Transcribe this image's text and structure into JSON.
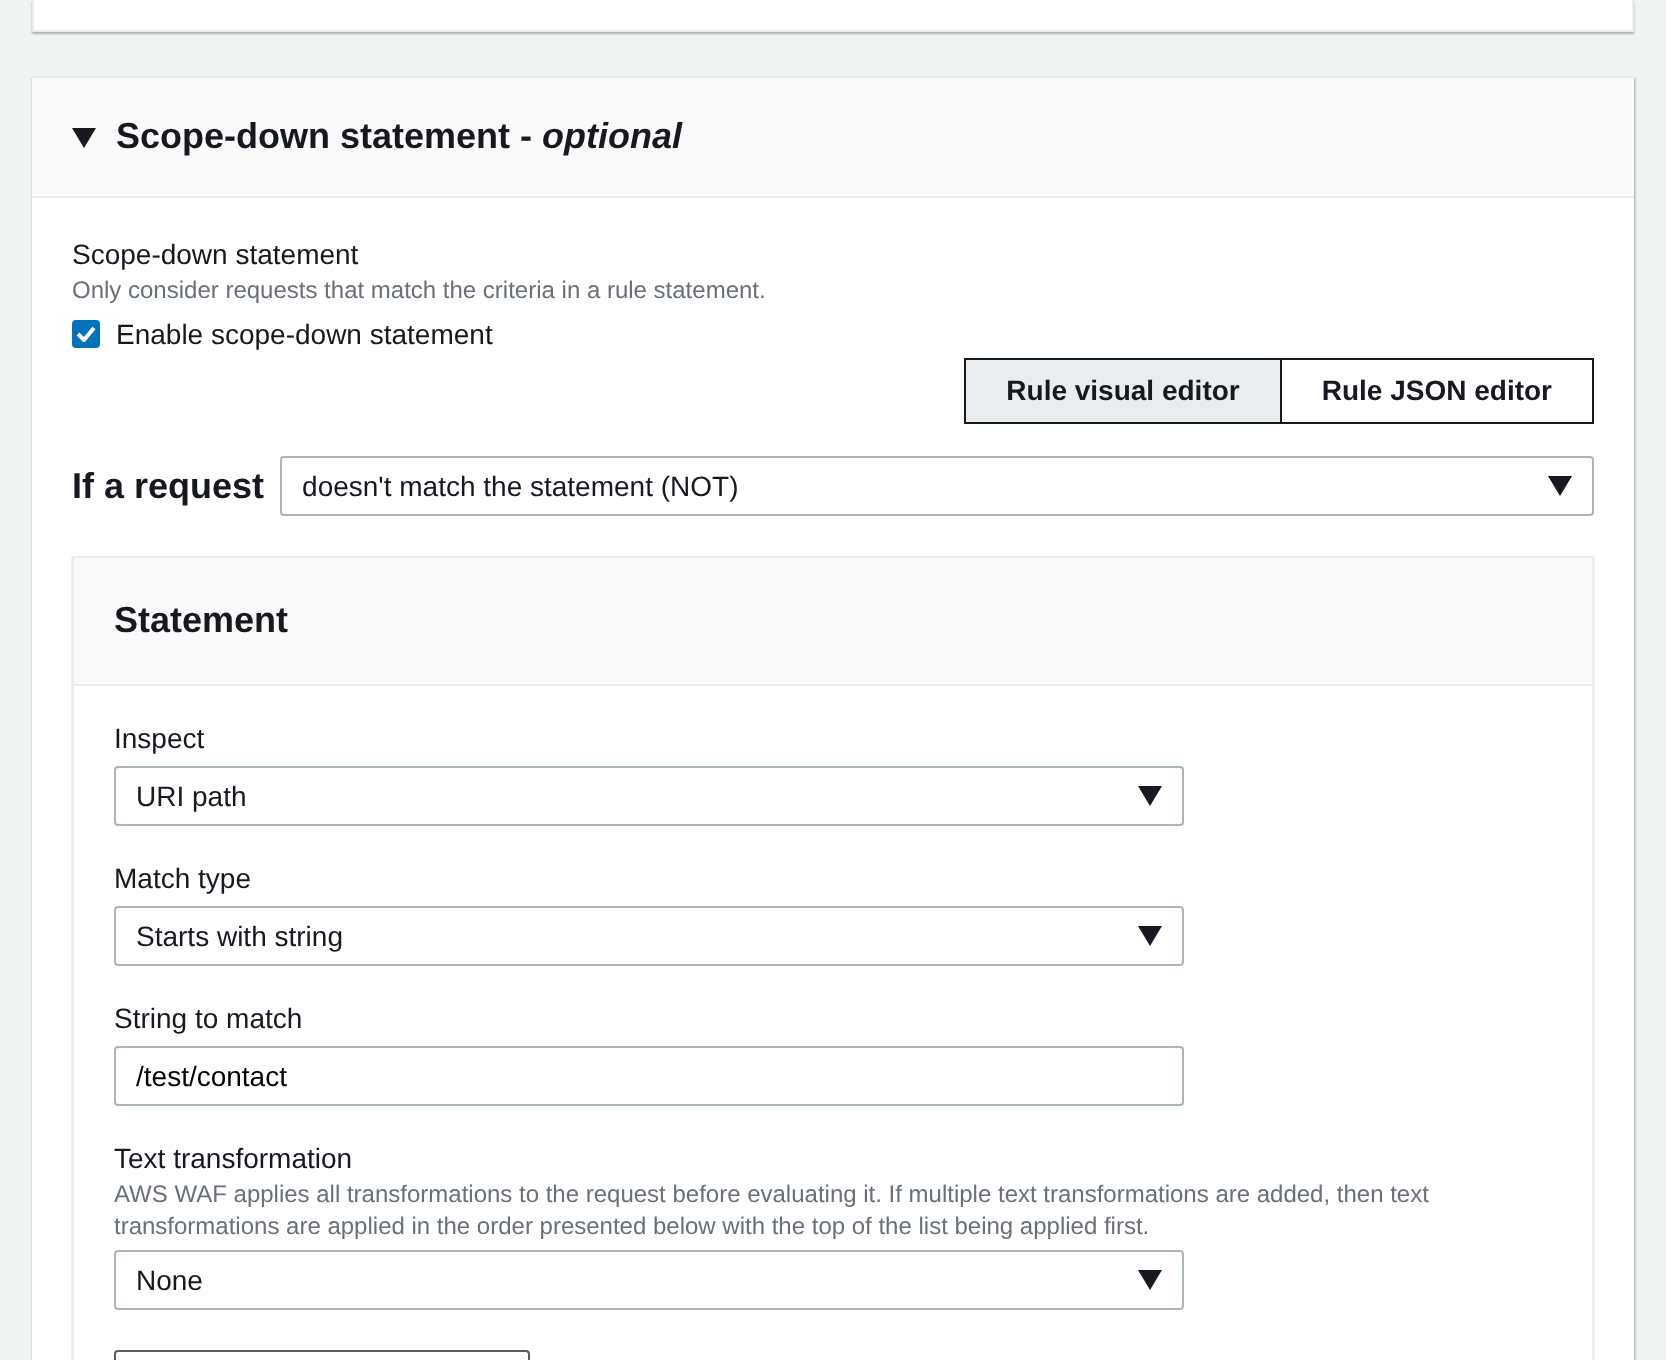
{
  "section": {
    "title": "Scope-down statement - *optional*",
    "expanded": true
  },
  "scope_field": {
    "label": "Scope-down statement",
    "description": "Only consider requests that match the criteria in a rule statement.",
    "checkbox": {
      "label": "Enable scope-down statement",
      "checked": true
    }
  },
  "editor_tabs": [
    {
      "label": "Rule visual editor",
      "selected": true
    },
    {
      "label": "Rule JSON editor",
      "selected": false
    }
  ],
  "condition": {
    "label": "If a request",
    "value": "doesn't match the statement (NOT)"
  },
  "statement": {
    "title": "Statement",
    "fields": [
      {
        "kind": "select",
        "label": "Inspect",
        "value": "URI path"
      },
      {
        "kind": "select",
        "label": "Match type",
        "value": "Starts with string"
      },
      {
        "kind": "input",
        "label": "String to match",
        "value": "/test/contact"
      },
      {
        "kind": "select",
        "label": "Text transformation",
        "description": "AWS WAF applies all transformations to the request before evaluating it. If multiple text transformations are added, then text transformations are applied in the order presented below with the top of the list being applied first.",
        "value": "None"
      }
    ]
  }
}
